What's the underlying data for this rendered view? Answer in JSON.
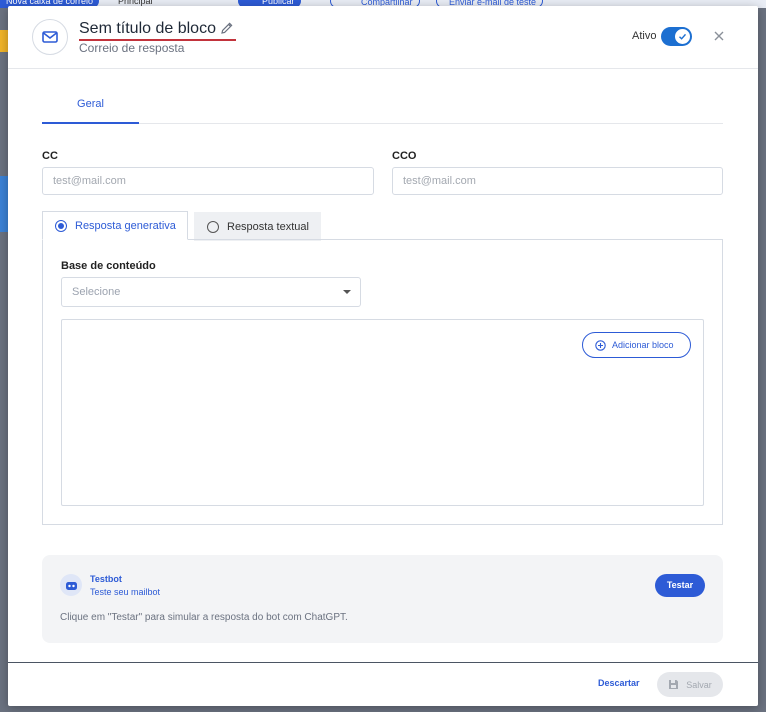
{
  "background": {
    "items": [
      "Nova caixa de correio",
      "Principal",
      "Publicar",
      "Compartilhar",
      "Enviar e-mail de teste"
    ]
  },
  "header": {
    "title": "Sem título de bloco",
    "subtitle": "Correio de resposta",
    "active_label": "Ativo",
    "active": true
  },
  "tabs": [
    {
      "label": "Geral",
      "active": true
    }
  ],
  "form": {
    "cc_label": "CC",
    "cc_placeholder": "test@mail.com",
    "cco_label": "CCO",
    "cco_placeholder": "test@mail.com"
  },
  "response_modes": [
    {
      "label": "Resposta generativa",
      "selected": true
    },
    {
      "label": "Resposta textual",
      "selected": false
    }
  ],
  "panel": {
    "content_base_label": "Base de conteúdo",
    "select_placeholder": "Selecione",
    "add_block_label": "Adicionar bloco"
  },
  "testbot": {
    "name": "Testbot",
    "subtitle": "Teste seu mailbot",
    "hint": "Clique em \"Testar\" para simular a resposta do bot com ChatGPT.",
    "test_button": "Testar"
  },
  "footer": {
    "discard_label": "Descartar",
    "save_label": "Salvar"
  },
  "colors": {
    "accent": "#2d5bd6",
    "toggle": "#1c6fd1",
    "title_underline": "#c2333c"
  }
}
